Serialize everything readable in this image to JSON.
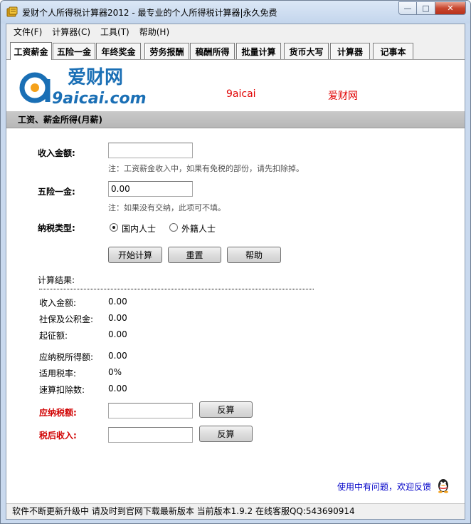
{
  "window": {
    "title": "爱财个人所得税计算器2012 - 最专业的个人所得税计算器|永久免费",
    "min_symbol": "—",
    "max_symbol": "□",
    "close_symbol": "✕"
  },
  "menu": [
    "文件(F)",
    "计算器(C)",
    "工具(T)",
    "帮助(H)"
  ],
  "tabs": [
    "工资薪金",
    "五险一金",
    "年终奖金",
    "劳务报酬",
    "稿酬所得",
    "批量计算",
    "货币大写",
    "计算器",
    "记事本"
  ],
  "banner": {
    "logo_cn": "爱财网",
    "logo_en": "9aicai.com",
    "link1": "9aicai",
    "link2": "爱财网"
  },
  "section_title": "工资、薪金所得(月薪)",
  "form": {
    "income_label": "收入金额:",
    "income_value": "",
    "income_note": "注：工资薪金收入中，如果有免税的部份，请先扣除掉。",
    "insurance_label": "五险一金:",
    "insurance_value": "0.00",
    "insurance_note": "注：如果没有交纳，此项可不填。",
    "tax_type_label": "纳税类型:",
    "radio_domestic": "国内人士",
    "radio_foreign": "外籍人士",
    "btn_calc": "开始计算",
    "btn_reset": "重置",
    "btn_help": "帮助"
  },
  "results": {
    "title": "计算结果:",
    "rows": [
      {
        "label": "收入金额:",
        "value": "0.00"
      },
      {
        "label": "社保及公积金:",
        "value": "0.00"
      },
      {
        "label": "起征额:",
        "value": "0.00"
      },
      {
        "label": "应纳税所得额:",
        "value": "0.00"
      },
      {
        "label": "适用税率:",
        "value": "0%"
      },
      {
        "label": "速算扣除数:",
        "value": "0.00"
      }
    ],
    "tax_label": "应纳税额:",
    "tax_value": "",
    "after_tax_label": "税后收入:",
    "after_tax_value": "",
    "reverse_btn": "反算"
  },
  "feedback_link": "使用中有问题，欢迎反馈",
  "status_text": "软件不断更新升级中 请及时到官网下载最新版本 当前版本1.9.2  在线客服QQ:543690914"
}
